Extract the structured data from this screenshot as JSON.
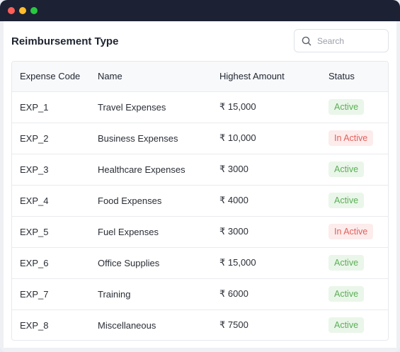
{
  "window": {
    "controls": [
      "close",
      "minimize",
      "maximize"
    ]
  },
  "page": {
    "title": "Reimbursement Type"
  },
  "search": {
    "placeholder": "Search",
    "value": "",
    "icon": "search-icon"
  },
  "table": {
    "headers": {
      "code": "Expense Code",
      "name": "Name",
      "amount": "Highest Amount",
      "status": "Status"
    },
    "rows": [
      {
        "code": "EXP_1",
        "name": "Travel Expenses",
        "amount": "₹ 15,000",
        "status": "Active"
      },
      {
        "code": "EXP_2",
        "name": "Business Expenses",
        "amount": "₹ 10,000",
        "status": "In Active"
      },
      {
        "code": "EXP_3",
        "name": "Healthcare Expenses",
        "amount": "₹ 3000",
        "status": "Active"
      },
      {
        "code": "EXP_4",
        "name": "Food Expenses",
        "amount": "₹ 4000",
        "status": "Active"
      },
      {
        "code": "EXP_5",
        "name": "Fuel Expenses",
        "amount": "₹ 3000",
        "status": "In Active"
      },
      {
        "code": "EXP_6",
        "name": "Office Supplies",
        "amount": "₹ 15,000",
        "status": "Active"
      },
      {
        "code": "EXP_7",
        "name": "Training",
        "amount": "₹ 6000",
        "status": "Active"
      },
      {
        "code": "EXP_8",
        "name": "Miscellaneous",
        "amount": "₹ 7500",
        "status": "Active"
      }
    ]
  },
  "colors": {
    "titlebar": "#1c2133",
    "active_bg": "#eaf6e9",
    "active_text": "#5cae57",
    "inactive_bg": "#fdecec",
    "inactive_text": "#e0605c"
  }
}
